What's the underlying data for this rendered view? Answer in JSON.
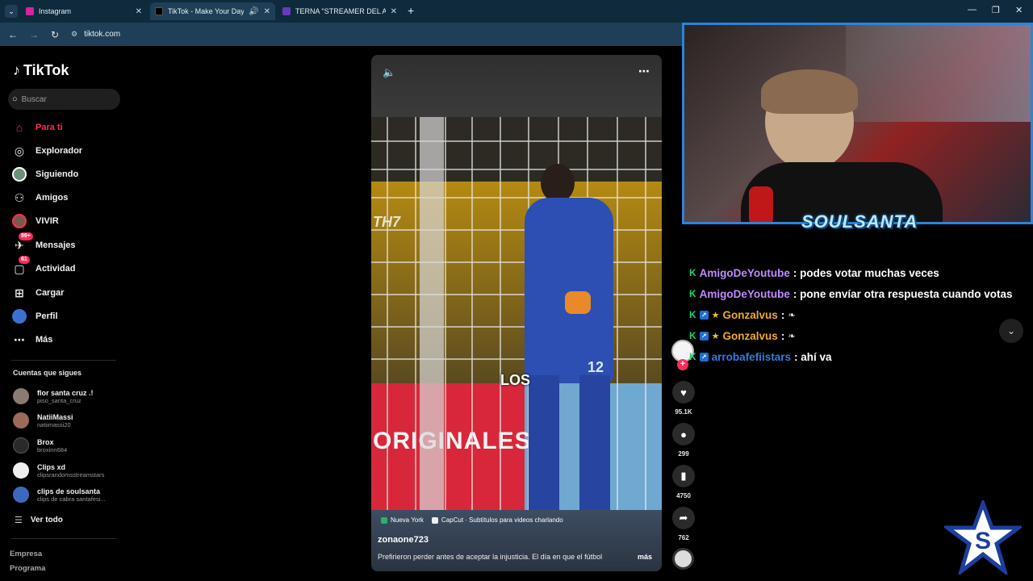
{
  "browser": {
    "tabs": [
      {
        "title": "Instagram",
        "icon": "instagram-icon",
        "color": "#d6249f"
      },
      {
        "title": "TikTok - Make Your Day",
        "icon": "tiktok-icon",
        "color": "#000000",
        "active": true
      },
      {
        "title": "TERNA \"STREAMER DEL AÑO\"",
        "icon": "form-icon",
        "color": "#673ab7"
      }
    ],
    "url": "tiktok.com"
  },
  "sidebar": {
    "logo": "TikTok",
    "search_placeholder": "Buscar",
    "nav": [
      {
        "label": "Para ti",
        "icon": "home-icon"
      },
      {
        "label": "Explorador",
        "icon": "compass-icon"
      },
      {
        "label": "Siguiendo",
        "icon": "following-icon"
      },
      {
        "label": "Amigos",
        "icon": "friends-icon"
      },
      {
        "label": "VIVIR",
        "icon": "live-icon"
      },
      {
        "label": "Mensajes",
        "icon": "messages-icon",
        "badge": "99+"
      },
      {
        "label": "Actividad",
        "icon": "activity-icon",
        "badge": "61"
      },
      {
        "label": "Cargar",
        "icon": "upload-icon"
      },
      {
        "label": "Perfil",
        "icon": "profile-icon"
      },
      {
        "label": "Más",
        "icon": "more-icon"
      }
    ],
    "following_title": "Cuentas que sigues",
    "following": [
      {
        "name": "flor santa cruz .!",
        "handle": "piso_santa_cruz"
      },
      {
        "name": "NatiiMassi",
        "handle": "natiimassi20"
      },
      {
        "name": "Brox",
        "handle": "broxinn684"
      },
      {
        "name": "Clips xd",
        "handle": "clipsrandomsstreamstars"
      },
      {
        "name": "clips de soulsanta",
        "handle": "clips de cabra santafesi..."
      }
    ],
    "see_all": "Ver todo",
    "footer": [
      "Empresa",
      "Programa"
    ]
  },
  "video": {
    "caption_overlay": "LOS",
    "tags": [
      "Nueva York",
      "CapCut · Subtítulos para videos charlando"
    ],
    "username": "zonaone723",
    "description": "Prefirieron perder antes de aceptar la injusticia. El día en que el fútbol",
    "more": "más",
    "scene_text_1": "TH7",
    "scene_text_2": "ORIGINALES",
    "jersey_number": "12"
  },
  "actions": {
    "likes": "95.1K",
    "comments": "299",
    "saves": "4750",
    "shares": "762"
  },
  "stream": {
    "overlay_name": "SOULSANTA",
    "chat": [
      {
        "user": "AmigoDeYoutube",
        "color": "#c08aff",
        "badges": [
          "K"
        ],
        "msg": ": podes votar muchas veces"
      },
      {
        "user": "AmigoDeYoutube",
        "color": "#c08aff",
        "badges": [
          "K"
        ],
        "msg": ": pone envíar otra respuesta cuando votas"
      },
      {
        "user": "Gonzalvus",
        "color": "#f0a830",
        "badges": [
          "K",
          "B",
          "S"
        ],
        "msg": ":"
      },
      {
        "user": "Gonzalvus",
        "color": "#f0a830",
        "badges": [
          "K",
          "B",
          "S"
        ],
        "msg": ":"
      },
      {
        "user": "arrobafefiistars",
        "color": "#2f7de0",
        "badges": [
          "K",
          "B"
        ],
        "msg": ": ahí va"
      }
    ]
  }
}
